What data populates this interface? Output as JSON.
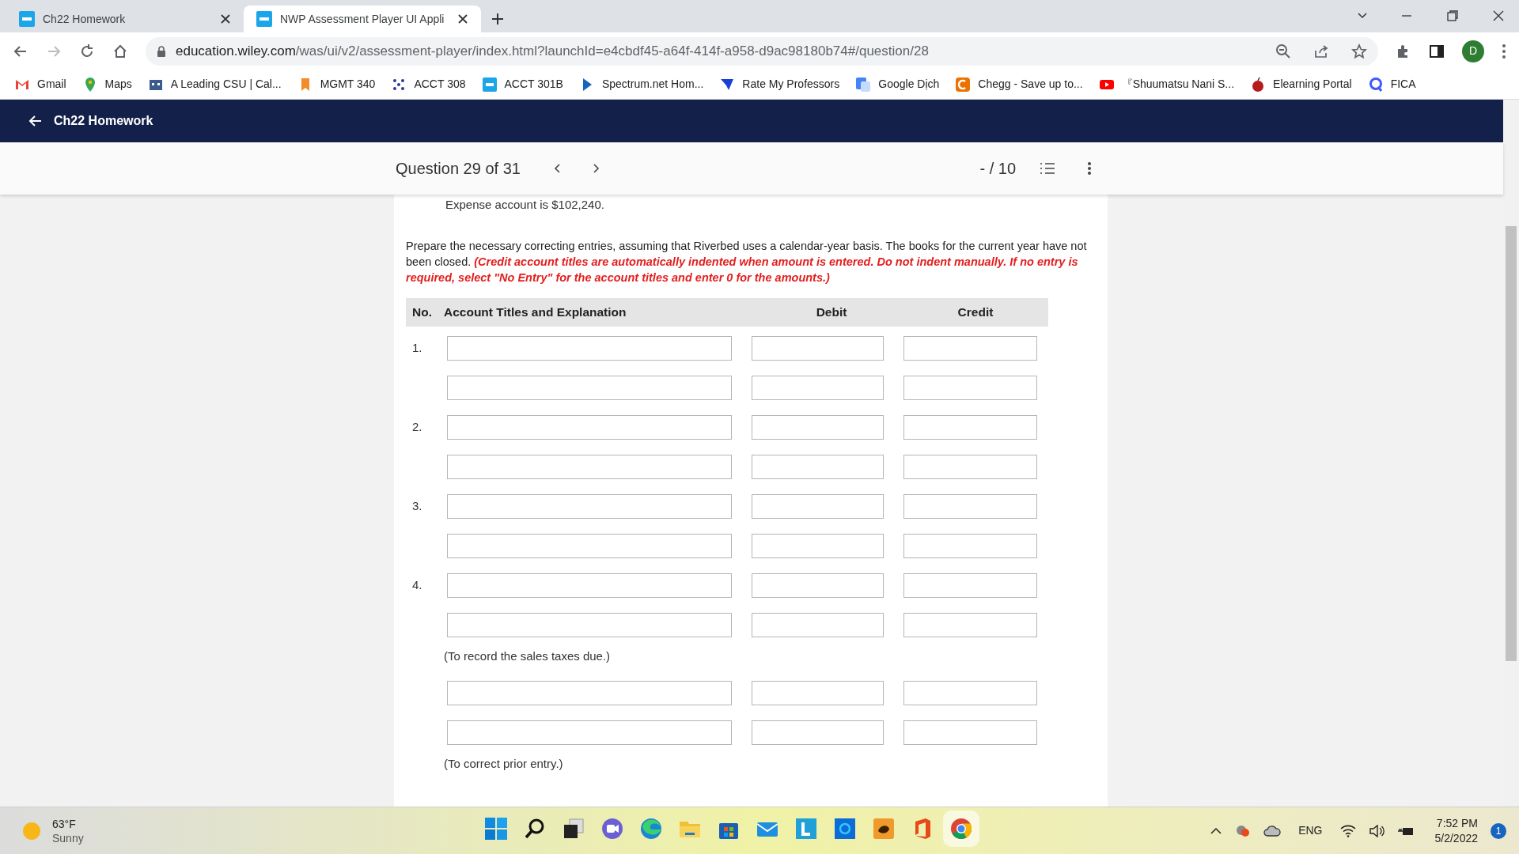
{
  "browser": {
    "tabs": [
      {
        "label": "Ch22 Homework",
        "selected": false
      },
      {
        "label": "NWP Assessment Player UI Appli",
        "selected": true
      }
    ],
    "url_host": "education.wiley.com",
    "url_path": "/was/ui/v2/assessment-player/index.html?launchId=e4cbdf45-a64f-414f-a958-d9ac98180b74#/question/28",
    "profile": "D",
    "bookmarks": [
      "Gmail",
      "Maps",
      "A Leading CSU | Cal...",
      "MGMT 340",
      "ACCT 308",
      "ACCT 301B",
      "Spectrum.net Hom...",
      "Rate My Professors",
      "Google Dịch",
      "Chegg - Save up to...",
      "『Shuumatsu Nani S...",
      "Elearning Portal",
      "FICA"
    ]
  },
  "app_header": {
    "back_label": "Ch22 Homework"
  },
  "question_bar": {
    "position": "Question 29 of 31",
    "score": "- / 10"
  },
  "question": {
    "previous_text": "Expense account is $102,240.",
    "instructions": "Prepare the necessary correcting entries, assuming that Riverbed uses a calendar-year basis. The books for the current year have not been closed.",
    "note": "(Credit account titles are automatically indented when amount is entered. Do not indent manually. If no entry is required, select \"No Entry\" for the account titles and enter 0 for the amounts.)"
  },
  "table": {
    "columns": [
      "No.",
      "Account Titles and Explanation",
      "Debit",
      "Credit"
    ],
    "rows": [
      {
        "kind": "numbered",
        "no": "1."
      },
      {
        "kind": "continuation"
      },
      {
        "kind": "numbered",
        "no": "2."
      },
      {
        "kind": "continuation"
      },
      {
        "kind": "numbered",
        "no": "3."
      },
      {
        "kind": "continuation"
      },
      {
        "kind": "numbered",
        "no": "4."
      },
      {
        "kind": "continuation"
      },
      {
        "kind": "note",
        "text": "(To record the sales taxes due.)"
      },
      {
        "kind": "continuation"
      },
      {
        "kind": "continuation"
      },
      {
        "kind": "note",
        "text": "(To correct prior entry.)"
      }
    ]
  },
  "taskbar": {
    "weather_temp": "63°F",
    "weather_text": "Sunny",
    "language": "ENG",
    "time": "7:52 PM",
    "date": "5/2/2022",
    "notifications": "1"
  }
}
